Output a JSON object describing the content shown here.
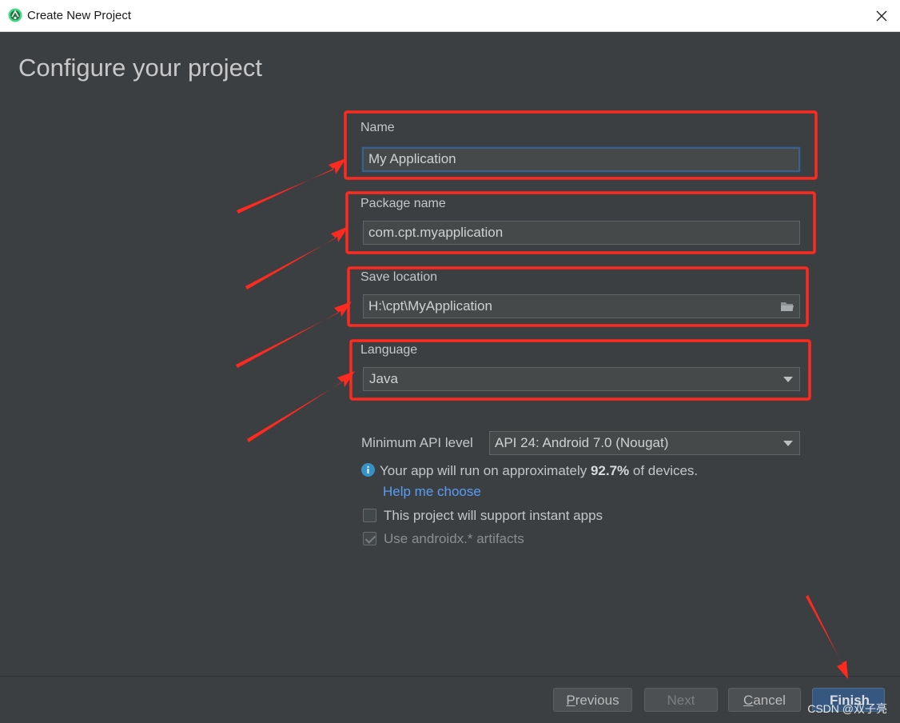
{
  "window": {
    "title": "Create New Project"
  },
  "page": {
    "heading": "Configure your project"
  },
  "form": {
    "name": {
      "label": "Name",
      "value": "My Application"
    },
    "package": {
      "label": "Package name",
      "value": "com.cpt.myapplication"
    },
    "location": {
      "label": "Save location",
      "value": "H:\\cpt\\MyApplication"
    },
    "language": {
      "label": "Language",
      "value": "Java"
    },
    "min_api": {
      "label": "Minimum API level",
      "value": "API 24: Android 7.0 (Nougat)"
    },
    "info": {
      "prefix": "Your app will run on approximately ",
      "percent": "92.7%",
      "suffix": " of devices."
    },
    "help_link": "Help me choose",
    "instant_apps": {
      "label": "This project will support instant apps",
      "checked": false
    },
    "androidx": {
      "label": "Use androidx.* artifacts",
      "checked": true,
      "disabled": true
    }
  },
  "footer": {
    "previous": {
      "mnemonic": "P",
      "rest": "revious"
    },
    "next": "Next",
    "cancel": {
      "mnemonic": "C",
      "rest": "ancel"
    },
    "finish": "Finish"
  },
  "watermark": "CSDN @双子亮",
  "colors": {
    "annotation_red": "#ff2a1f",
    "link_blue": "#589df6",
    "primary_button": "#365880",
    "background": "#3c3f41"
  },
  "icons": {
    "app": "android-studio-icon",
    "close": "close-icon",
    "folder": "folder-icon",
    "dropdown": "chevron-down-icon",
    "info": "info-icon"
  }
}
